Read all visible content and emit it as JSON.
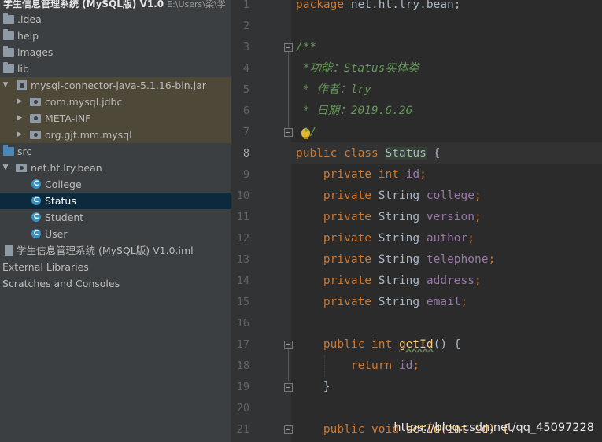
{
  "project_title": "学生信息管理系统 (MySQL版) V1.0",
  "project_path": "E:\\Users\\梁\\学",
  "tree": {
    "folders": {
      "idea": ".idea",
      "help": "help",
      "images": "images",
      "lib": "lib"
    },
    "jar": "mysql-connector-java-5.1.16-bin.jar",
    "jar_packages": [
      "com.mysql.jdbc",
      "META-INF",
      "org.gjt.mm.mysql"
    ],
    "src": "src",
    "package": "net.ht.lry.bean",
    "classes": [
      "College",
      "Status",
      "Student",
      "User"
    ],
    "selected_class": "Status",
    "iml_file": "学生信息管理系统 (MySQL版) V1.0.iml",
    "external_libraries": "External Libraries",
    "scratches": "Scratches and Consoles"
  },
  "editor": {
    "line_numbers": [
      "1",
      "2",
      "3",
      "4",
      "5",
      "6",
      "7",
      "8",
      "9",
      "10",
      "11",
      "12",
      "13",
      "14",
      "15",
      "16",
      "17",
      "18",
      "19",
      "20",
      "21"
    ],
    "current_line": "8",
    "code": {
      "l1_kw": "package",
      "l1_rest": " net.ht.lry.bean;",
      "l3": "/**",
      "l4": " *功能：Status实体类",
      "l5": " * 作者：lry",
      "l6": " * 日期：2019.6.26",
      "l7": " */",
      "l8_kw": "public class ",
      "l8_name": "Status",
      "l8_rest": " {",
      "fields": [
        {
          "kw": "    private ",
          "type": "int ",
          "name": "id",
          "semi": ";"
        },
        {
          "kw": "    private ",
          "type": "String ",
          "name": "college",
          "semi": ";"
        },
        {
          "kw": "    private ",
          "type": "String ",
          "name": "version",
          "semi": ";"
        },
        {
          "kw": "    private ",
          "type": "String ",
          "name": "author",
          "semi": ";"
        },
        {
          "kw": "    private ",
          "type": "String ",
          "name": "telephone",
          "semi": ";"
        },
        {
          "kw": "    private ",
          "type": "String ",
          "name": "address",
          "semi": ";"
        },
        {
          "kw": "    private ",
          "type": "String ",
          "name": "email",
          "semi": ";"
        }
      ],
      "l17_kw": "    public int ",
      "l17_name": "getId",
      "l17_rest": "() {",
      "l18_kw": "        return ",
      "l18_name": "id",
      "l18_semi": ";",
      "l19": "    }",
      "l21_kw": "    public void ",
      "l21_rest": "setId(int id) {"
    }
  },
  "watermark": "https://blog.csdn.net/qq_45097228",
  "colors": {
    "keyword": "#cc7832",
    "field": "#9876aa",
    "comment": "#629755",
    "text": "#a9b7c6",
    "selection": "#0d293e",
    "library_bg": "#4d4838"
  }
}
